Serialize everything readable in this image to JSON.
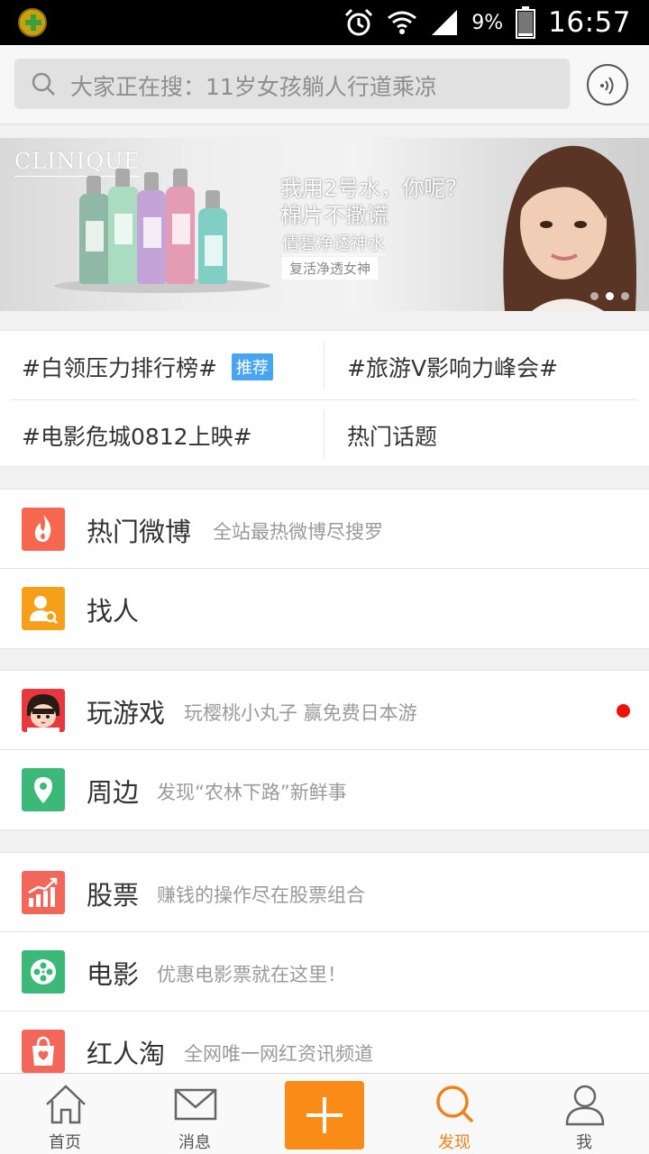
{
  "status_bar": {
    "battery": "9%",
    "time": "16:57",
    "icons": [
      "app-badge-icon",
      "alarm-icon",
      "wifi-icon",
      "signal-icon",
      "battery-icon"
    ]
  },
  "search": {
    "placeholder": "大家正在搜：11岁女孩躺人行道乘凉",
    "voice_icon": "voice-icon"
  },
  "banner": {
    "brand": "CLINIQUE",
    "headline_1": "我用2号水，你呢？",
    "headline_2": "棉片不撒谎",
    "product": "倩碧净透神水",
    "tagline": "复活净透女神",
    "slide_count": 3,
    "active_slide": 2
  },
  "topics": [
    {
      "label": "#白领压力排行榜#",
      "badge": "推荐"
    },
    {
      "label": "#旅游V影响力峰会#"
    },
    {
      "label": "#电影危城0812上映#"
    },
    {
      "label": "热门话题"
    }
  ],
  "sections": [
    [
      {
        "title": "热门微博",
        "subtitle": "全站最热微博尽搜罗",
        "icon": "hot-fire-icon",
        "color": "#f5684f"
      },
      {
        "title": "找人",
        "subtitle": "",
        "icon": "find-people-icon",
        "color": "#f6a019"
      }
    ],
    [
      {
        "title": "玩游戏",
        "subtitle": "玩樱桃小丸子 赢免费日本游",
        "icon": "game-chibi-icon",
        "color": "#e8383d",
        "has_dot": true
      },
      {
        "title": "周边",
        "subtitle": "发现“农林下路”新鲜事",
        "icon": "location-pin-icon",
        "color": "#3cb878"
      }
    ],
    [
      {
        "title": "股票",
        "subtitle": "赚钱的操作尽在股票组合",
        "icon": "stock-chart-icon",
        "color": "#f2675a"
      },
      {
        "title": "电影",
        "subtitle": "优惠电影票就在这里！",
        "icon": "film-reel-icon",
        "color": "#3cb878"
      },
      {
        "title": "红人淘",
        "subtitle": "全网唯一网红资讯频道",
        "icon": "shopping-bag-icon",
        "color": "#f2675a"
      }
    ]
  ],
  "tabbar": {
    "home": "首页",
    "messages": "消息",
    "discover": "发现",
    "me": "我",
    "active": "discover",
    "accent": "#f08018"
  }
}
